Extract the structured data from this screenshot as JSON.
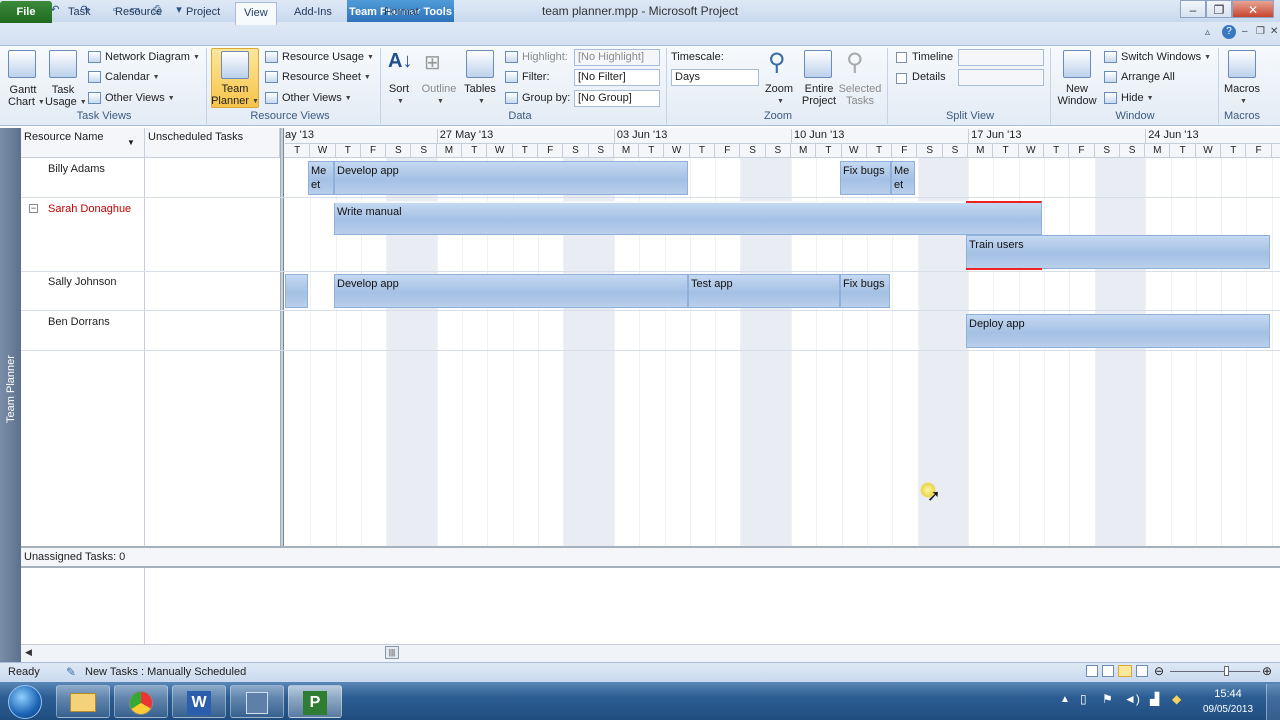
{
  "window": {
    "title": "team planner.mpp - Microsoft Project",
    "contextual_tab": "Team Planner Tools"
  },
  "tabs": [
    "File",
    "Task",
    "Resource",
    "Project",
    "View",
    "Add-Ins",
    "Format"
  ],
  "ribbon": {
    "task_views": {
      "label": "Task Views",
      "gantt": "Gantt",
      "gantt2": "Chart",
      "task_usage": "Task",
      "task_usage2": "Usage",
      "network_diagram": "Network Diagram",
      "calendar": "Calendar",
      "other_views": "Other Views"
    },
    "resource_views": {
      "label": "Resource Views",
      "team_planner": "Team",
      "team_planner2": "Planner",
      "resource_usage": "Resource Usage",
      "resource_sheet": "Resource Sheet",
      "other_views": "Other Views"
    },
    "data": {
      "label": "Data",
      "sort": "Sort",
      "outline": "Outline",
      "tables": "Tables",
      "highlight_label": "Highlight:",
      "highlight_value": "[No Highlight]",
      "filter_label": "Filter:",
      "filter_value": "[No Filter]",
      "group_label": "Group by:",
      "group_value": "[No Group]"
    },
    "zoom": {
      "label": "Zoom",
      "timescale_label": "Timescale:",
      "timescale_value": "Days",
      "zoom": "Zoom",
      "entire_project": "Entire",
      "entire_project2": "Project",
      "selected_tasks": "Selected",
      "selected_tasks2": "Tasks"
    },
    "split_view": {
      "label": "Split View",
      "timeline": "Timeline",
      "details": "Details"
    },
    "window": {
      "label": "Window",
      "new_window": "New",
      "new_window2": "Window",
      "switch_windows": "Switch Windows",
      "arrange_all": "Arrange All",
      "hide": "Hide"
    },
    "macros": {
      "label": "Macros",
      "macros": "Macros"
    }
  },
  "grid": {
    "col_resource": "Resource Name",
    "col_unscheduled": "Unscheduled Tasks",
    "weeks": [
      "ay '13",
      "27 May '13",
      "03 Jun '13",
      "10 Jun '13",
      "17 Jun '13",
      "24 Jun '13"
    ],
    "days": [
      "T",
      "W",
      "T",
      "F",
      "S",
      "S",
      "M",
      "T",
      "W",
      "T",
      "F",
      "S",
      "S",
      "M",
      "T",
      "W",
      "T",
      "F",
      "S",
      "S",
      "M",
      "T",
      "W",
      "T",
      "F",
      "S",
      "S",
      "M",
      "T",
      "W",
      "T",
      "F",
      "S",
      "S",
      "M",
      "T",
      "W",
      "T",
      "F"
    ],
    "resources": [
      "Billy Adams",
      "Sarah Donaghue",
      "Sally Johnson",
      "Ben Dorrans"
    ],
    "tasks": {
      "meet1": "Me et",
      "develop1": "Develop app",
      "fixbugs1": "Fix bugs",
      "meet2": "Me et",
      "write_manual": "Write manual",
      "train_users": "Train users",
      "develop2": "Develop app",
      "test_app": "Test app",
      "fixbugs2": "Fix bugs",
      "deploy": "Deploy app"
    },
    "unassigned": "Unassigned Tasks: 0"
  },
  "sidebar": {
    "label": "Team Planner"
  },
  "status": {
    "ready": "Ready",
    "new_tasks": "New Tasks : Manually Scheduled"
  },
  "taskbar": {
    "time": "15:44",
    "date": "09/05/2013"
  }
}
